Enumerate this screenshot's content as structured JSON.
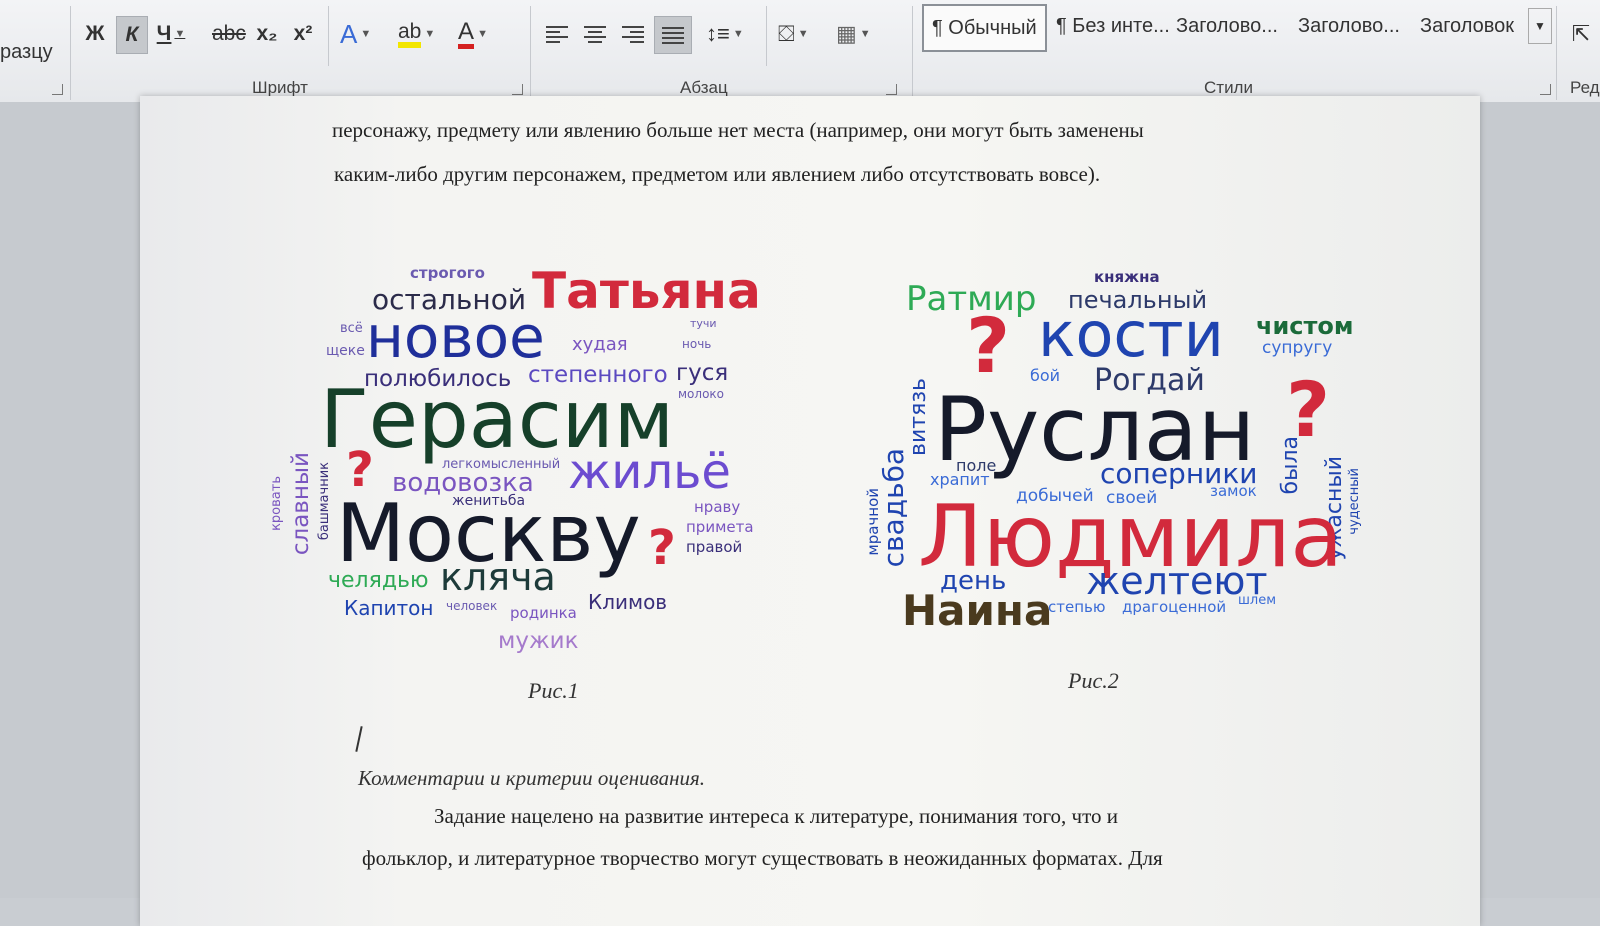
{
  "ribbon": {
    "clipboard_fragment": "разцу",
    "font_group_label": "Шрифт",
    "paragraph_group_label": "Абзац",
    "styles_group_label": "Стили",
    "editing_fragment": "Ред",
    "font_buttons": {
      "bold": "Ж",
      "italic": "К",
      "underline": "Ч",
      "strikethrough": "abc",
      "subscript": "x₂",
      "superscript": "x²",
      "text_effects": "A",
      "highlight": "ab",
      "font_color": "A"
    },
    "styles": [
      "¶ Обычный",
      "¶ Без инте...",
      "Заголово...",
      "Заголово...",
      "Заголовок"
    ],
    "colors": {
      "highlight": "#f2e600",
      "font_color": "#d42020",
      "text_effects": "#3a6bd6"
    }
  },
  "document": {
    "paragraph_lines": [
      "персонажу, предмету или явлению больше нет места (например, они могут быть заменены",
      "каким-либо другим персонажем, предметом или явлением либо отсутствовать вовсе)."
    ],
    "figure1_caption": "Рис.1",
    "figure2_caption": "Рис.2",
    "section_heading": "Комментарии и критерии оценивания.",
    "closing_lines": [
      "Задание нацелено на развитие интереса к литературе, понимания того, что и",
      "фольклор, и литературное творчество могут существовать в неожиданных форматах. Для"
    ]
  },
  "cloud1": {
    "words": {
      "strogogo": "строгого",
      "ostalnoy": "остальной",
      "tatyana": "Татьяна",
      "vse": "всё",
      "novoe": "новое",
      "khudaya": "худая",
      "tuchi": "тучи",
      "noch": "ночь",
      "scheke": "щеке",
      "polyubilos": "полюбилось",
      "stepennogo": "степенного",
      "gusya": "гуся",
      "moloko": "молоко",
      "gerasim": "Герасим",
      "legkomyslenny": "легкомысленный",
      "q1": "?",
      "vodovozka": "водовозка",
      "zhilyo": "жильё",
      "zhenitba": "женитьба",
      "slavny": "славный",
      "krovat": "кровать",
      "bashmachnik": "башмачник",
      "moskvu": "Москву",
      "q2": "?",
      "nravu": "нраву",
      "primeta": "примета",
      "pravoy": "правой",
      "chelyadyu": "челядью",
      "klyacha": "кляча",
      "kapiton": "Капитон",
      "chelovek": "человек",
      "rodinka": "родинка",
      "klimov": "Климов",
      "muzhik": "мужик"
    }
  },
  "cloud2": {
    "words": {
      "knyazhna": "княжна",
      "ratmir": "Ратмир",
      "pechalny": "печальный",
      "chistom": "чистом",
      "q1": "?",
      "kosti": "кости",
      "suprugu": "супругу",
      "boy": "бой",
      "rogday": "Рогдай",
      "q2": "?",
      "vityaz": "витязь",
      "ruslan": "Руслан",
      "svadba": "свадьба",
      "pole": "поле",
      "khrapit": "храпит",
      "soperniki": "соперники",
      "byla": "была",
      "dobychey": "добычей",
      "svoey": "своей",
      "zamok": "замок",
      "uzhasny": "ужасный",
      "chudesny": "чудесный",
      "mrachnoy": "мрачной",
      "lyudmila": "Людмила",
      "den": "день",
      "zhelteyut": "желтеют",
      "naina": "Наина",
      "stepyu": "степью",
      "dragocennoy": "драгоценной",
      "shlem": "шлем"
    }
  }
}
